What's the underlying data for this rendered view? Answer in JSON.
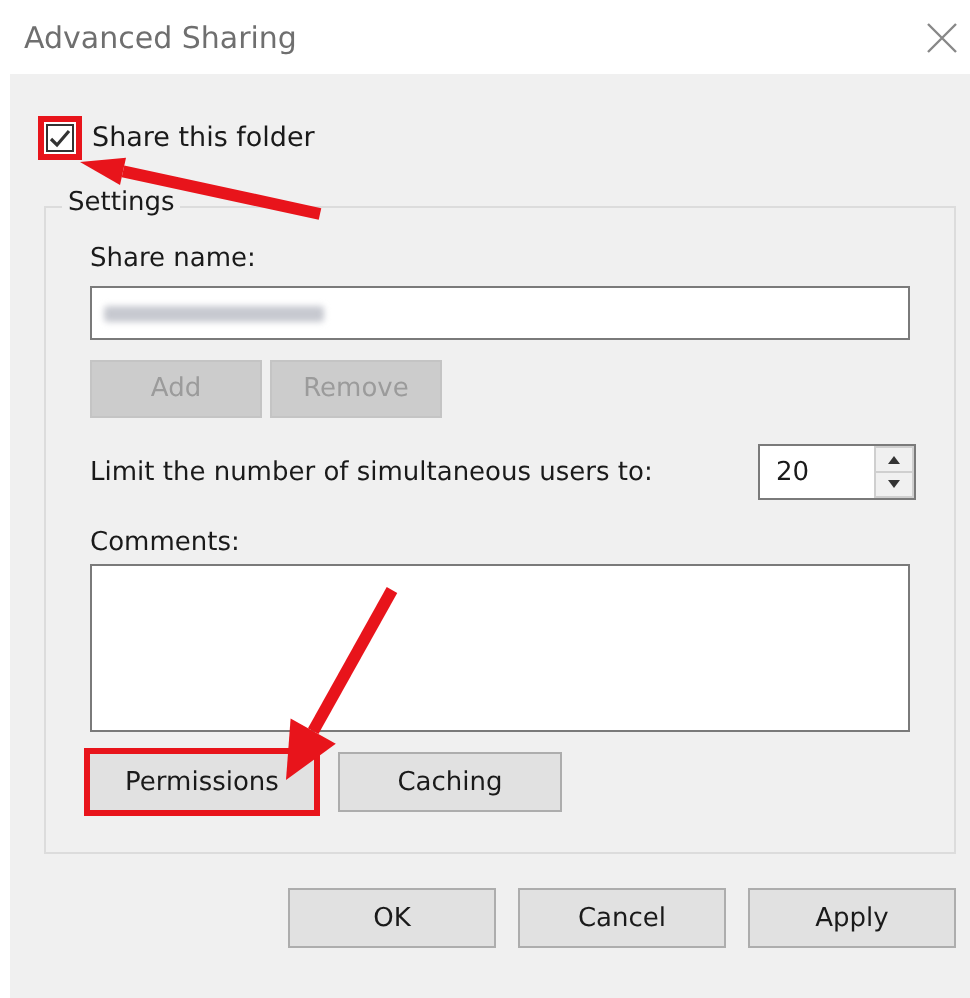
{
  "window": {
    "title": "Advanced Sharing"
  },
  "share_checkbox": {
    "label": "Share this folder",
    "checked": true,
    "highlighted": true
  },
  "settings": {
    "title": "Settings",
    "share_name": {
      "label": "Share name:"
    },
    "name_buttons": [
      {
        "label": "Add",
        "disabled": true
      },
      {
        "label": "Remove",
        "disabled": true
      }
    ],
    "user_limit": {
      "label": "Limit the number of simultaneous users to:",
      "value": "20"
    },
    "comments": {
      "label": "Comments:"
    },
    "buttons": [
      {
        "label": "Permissions",
        "highlighted": true
      },
      {
        "label": "Caching",
        "highlighted": false
      }
    ]
  },
  "buttons": [
    {
      "label": "OK"
    },
    {
      "label": "Cancel"
    },
    {
      "label": "Apply"
    }
  ]
}
